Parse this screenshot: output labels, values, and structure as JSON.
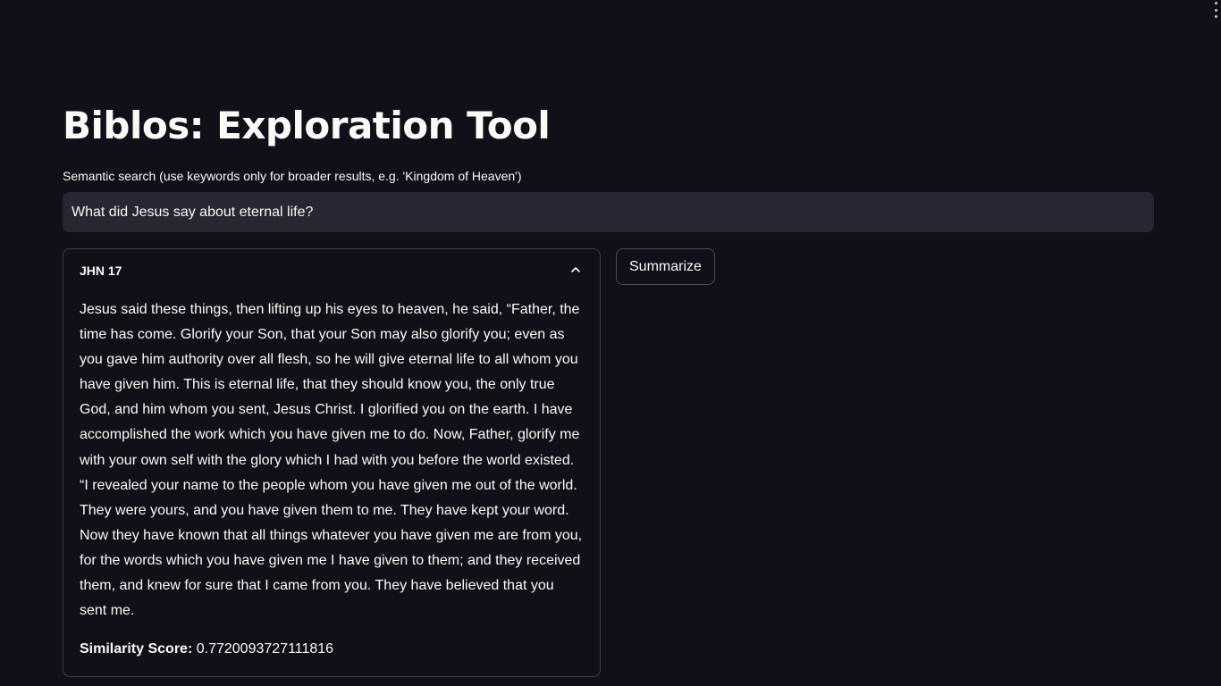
{
  "page": {
    "title": "Biblos: Exploration Tool"
  },
  "search": {
    "label": "Semantic search (use keywords only for broader results, e.g. 'Kingdom of Heaven')",
    "value": "What did Jesus say about eternal life?"
  },
  "results": [
    {
      "reference": "JHN 17",
      "expanded": true,
      "text": "Jesus said these things, then lifting up his eyes to heaven, he said, “Father, the time has come. Glorify your Son, that your Son may also glorify you; even as you gave him authority over all flesh, so he will give eternal life to all whom you have given him. This is eternal life, that they should know you, the only true God, and him whom you sent, Jesus Christ. I glorified you on the earth. I have accomplished the work which you have given me to do. Now, Father, glorify me with your own self with the glory which I had with you before the world existed. “I revealed your name to the people whom you have given me out of the world. They were yours, and you have given them to me. They have kept your word. Now they have known that all things whatever you have given me are from you, for the words which you have given me I have given to them; and they received them, and knew for sure that I came from you. They have believed that you sent me.",
      "score_label": "Similarity Score:",
      "score_value": "0.7720093727111816"
    }
  ],
  "actions": {
    "summarize_label": "Summarize"
  },
  "icons": {
    "menu": "kebab-menu-icon",
    "collapse": "chevron-up-icon"
  },
  "colors": {
    "background": "#0e1117",
    "input_background": "#262730",
    "border": "#3d3f48",
    "text": "#fafafa"
  }
}
